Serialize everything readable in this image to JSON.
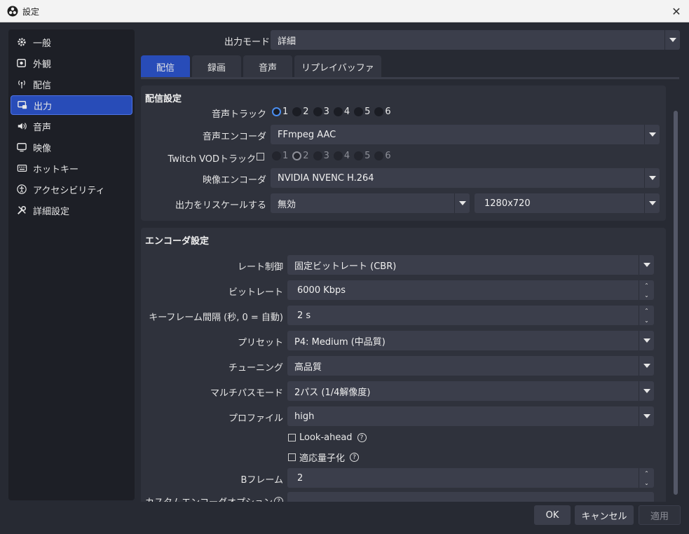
{
  "window": {
    "title": "設定"
  },
  "sidebar": {
    "items": [
      {
        "label": "一般",
        "icon": "gear-icon"
      },
      {
        "label": "外観",
        "icon": "appearance-icon"
      },
      {
        "label": "配信",
        "icon": "broadcast-icon"
      },
      {
        "label": "出力",
        "icon": "output-icon",
        "active": true
      },
      {
        "label": "音声",
        "icon": "speaker-icon"
      },
      {
        "label": "映像",
        "icon": "monitor-icon"
      },
      {
        "label": "ホットキー",
        "icon": "keyboard-icon"
      },
      {
        "label": "アクセシビリティ",
        "icon": "accessibility-icon"
      },
      {
        "label": "詳細設定",
        "icon": "tools-icon"
      }
    ]
  },
  "output_mode": {
    "label": "出力モード",
    "value": "詳細"
  },
  "tabs": [
    {
      "label": "配信",
      "active": true
    },
    {
      "label": "録画"
    },
    {
      "label": "音声"
    },
    {
      "label": "リプレイバッファ"
    }
  ],
  "stream_settings": {
    "title": "配信設定",
    "audio_track": {
      "label": "音声トラック",
      "options": [
        "1",
        "2",
        "3",
        "4",
        "5",
        "6"
      ],
      "selected": "1"
    },
    "audio_encoder": {
      "label": "音声エンコーダ",
      "value": "FFmpeg AAC"
    },
    "twitch_vod": {
      "label": "Twitch VODトラック",
      "options": [
        "1",
        "2",
        "3",
        "4",
        "5",
        "6"
      ],
      "selected": "2"
    },
    "video_encoder": {
      "label": "映像エンコーダ",
      "value": "NVIDIA NVENC H.264"
    },
    "rescale": {
      "label": "出力をリスケールする",
      "value": "無効",
      "resolution": "1280x720"
    }
  },
  "encoder_settings": {
    "title": "エンコーダ設定",
    "rate_control": {
      "label": "レート制御",
      "value": "固定ビットレート (CBR)"
    },
    "bitrate": {
      "label": "ビットレート",
      "value": "6000 Kbps"
    },
    "keyframe": {
      "label": "キーフレーム間隔 (秒, 0 = 自動)",
      "value": "2 s"
    },
    "preset": {
      "label": "プリセット",
      "value": "P4: Medium (中品質)"
    },
    "tuning": {
      "label": "チューニング",
      "value": "高品質"
    },
    "multipass": {
      "label": "マルチパスモード",
      "value": "2パス (1/4解像度)"
    },
    "profile": {
      "label": "プロファイル",
      "value": "high"
    },
    "lookahead": {
      "label": "Look-ahead"
    },
    "adaptive_quant": {
      "label": "適応量子化"
    },
    "bframes": {
      "label": "Bフレーム",
      "value": "2"
    },
    "custom_options": {
      "label": "カスタムエンコーダオプション"
    }
  },
  "footer": {
    "ok": "OK",
    "cancel": "キャンセル",
    "apply": "適用"
  }
}
